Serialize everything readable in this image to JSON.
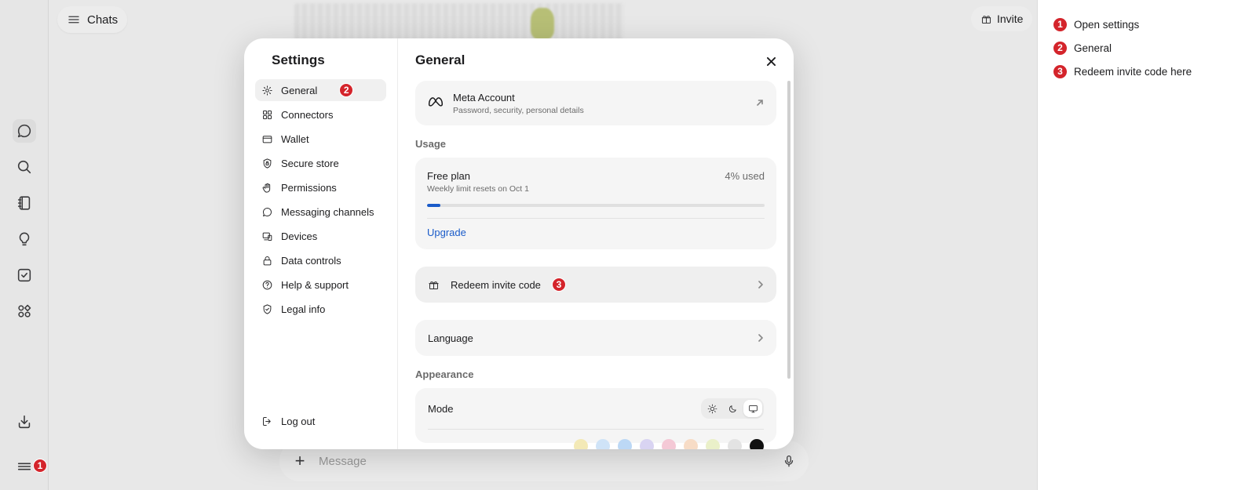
{
  "header": {
    "chats_label": "Chats",
    "invite_label": "Invite"
  },
  "rail": {
    "menu_badge": "1"
  },
  "composer": {
    "placeholder": "Message"
  },
  "settings": {
    "title": "Settings",
    "nav": [
      {
        "label": "General",
        "icon": "gear-icon",
        "active": true,
        "badge": "2"
      },
      {
        "label": "Connectors",
        "icon": "grid-icon"
      },
      {
        "label": "Wallet",
        "icon": "wallet-icon"
      },
      {
        "label": "Secure store",
        "icon": "shield-lock-icon"
      },
      {
        "label": "Permissions",
        "icon": "hand-icon"
      },
      {
        "label": "Messaging channels",
        "icon": "chat-bubble-icon"
      },
      {
        "label": "Devices",
        "icon": "devices-icon"
      },
      {
        "label": "Data controls",
        "icon": "lock-icon"
      },
      {
        "label": "Help & support",
        "icon": "question-icon"
      },
      {
        "label": "Legal info",
        "icon": "shield-check-icon"
      }
    ],
    "logout_label": "Log out"
  },
  "general": {
    "title": "General",
    "account": {
      "title": "Meta Account",
      "subtitle": "Password, security, personal details"
    },
    "usage": {
      "section_label": "Usage",
      "plan": "Free plan",
      "reset_text": "Weekly limit resets on Oct 1",
      "used_text": "4% used",
      "used_fraction": 0.04,
      "upgrade_label": "Upgrade"
    },
    "redeem": {
      "label": "Redeem invite code",
      "badge": "3"
    },
    "language": {
      "label": "Language"
    },
    "appearance": {
      "section_label": "Appearance",
      "mode_label": "Mode",
      "selected_mode": "system"
    },
    "swatches": [
      "#f3e9b6",
      "#cfe3f7",
      "#bcd8f5",
      "#d9d4f2",
      "#f4c9d6",
      "#f7dcc6",
      "#eaf0c9",
      "#e3e3e3",
      "#111111"
    ]
  },
  "annotations": [
    {
      "num": "1",
      "label": "Open settings"
    },
    {
      "num": "2",
      "label": "General"
    },
    {
      "num": "3",
      "label": "Redeem invite code here"
    }
  ],
  "colors": {
    "accent": "#1a5bc9",
    "badge": "#d4242b"
  }
}
